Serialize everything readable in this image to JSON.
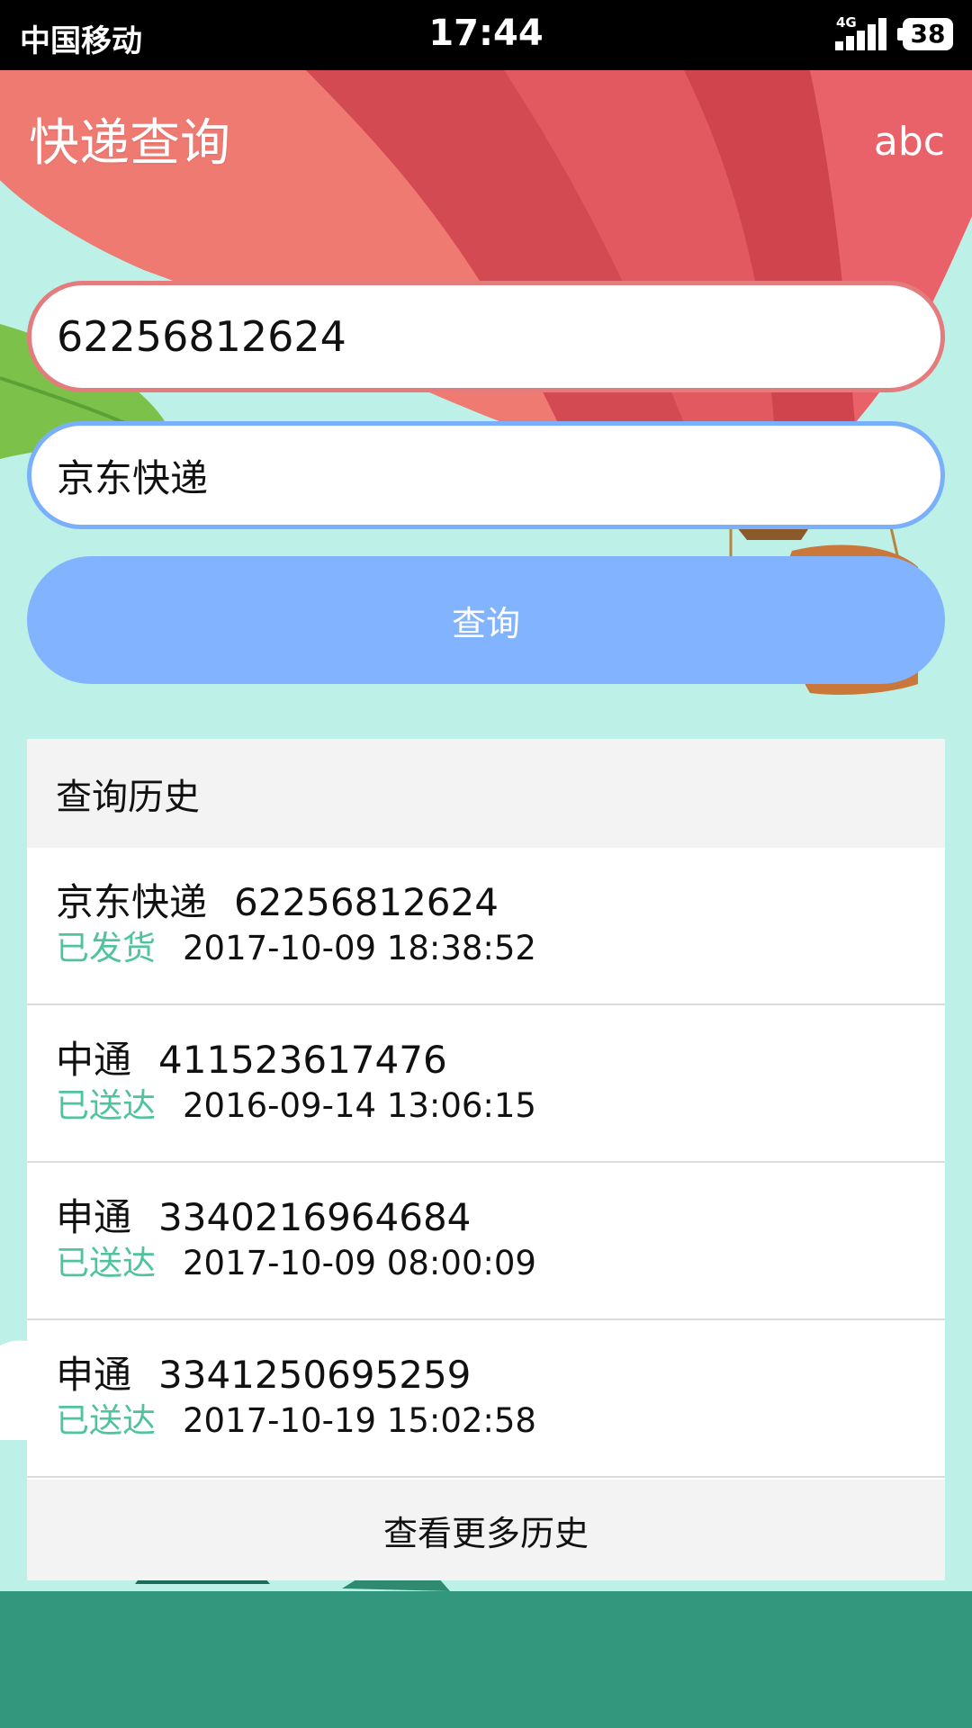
{
  "status_bar": {
    "carrier": "中国移动",
    "time": "17:44",
    "network": "4G",
    "battery": "38"
  },
  "header": {
    "title": "快递查询",
    "right_text": "abc"
  },
  "form": {
    "tracking_number": "62256812624",
    "company": "京东快递",
    "submit_label": "查询"
  },
  "history": {
    "title": "查询历史",
    "items": [
      {
        "company": "京东快递",
        "number": "62256812624",
        "status": "已发货",
        "time": "2017-10-09 18:38:52"
      },
      {
        "company": "中通",
        "number": "411523617476",
        "status": "已送达",
        "time": "2016-09-14 13:06:15"
      },
      {
        "company": "申通",
        "number": "3340216964684",
        "status": "已送达",
        "time": "2017-10-09 08:00:09"
      },
      {
        "company": "申通",
        "number": "3341250695259",
        "status": "已送达",
        "time": "2017-10-19 15:02:58"
      }
    ],
    "more_label": "查看更多历史"
  },
  "colors": {
    "background": "#bdf0e6",
    "button": "#82b3fe",
    "status_green": "#4fc39b",
    "number_field_border": "#e47b7d",
    "company_field_border": "#7ab0fb"
  },
  "icons": [
    "signal-icon",
    "battery-icon"
  ]
}
